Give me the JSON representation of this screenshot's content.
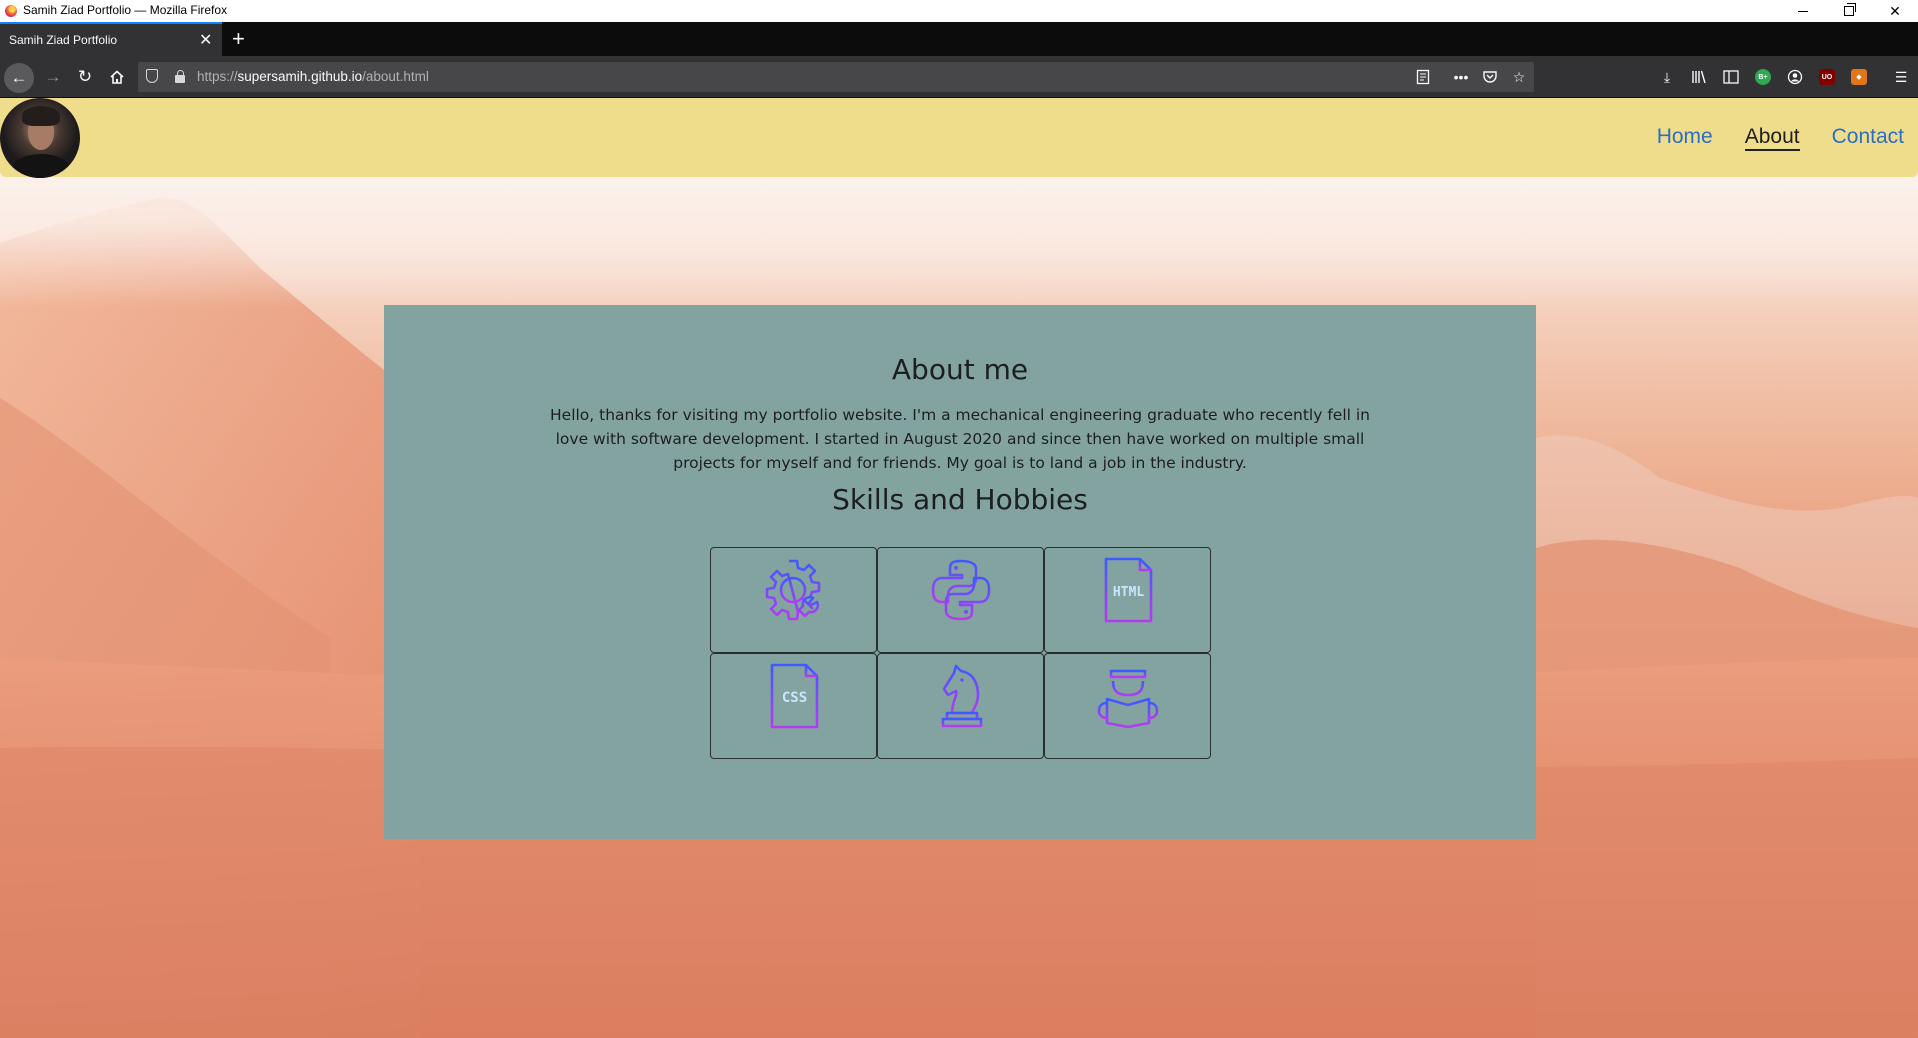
{
  "window": {
    "title": "Samih Ziad Portfolio — Mozilla Firefox"
  },
  "tab": {
    "title": "Samih Ziad Portfolio"
  },
  "urlbar": {
    "scheme": "https://",
    "host": "supersamih.github.io",
    "path": "/about.html"
  },
  "nav": {
    "links": [
      {
        "label": "Home",
        "active": false
      },
      {
        "label": "About",
        "active": true
      },
      {
        "label": "Contact",
        "active": false
      }
    ]
  },
  "about": {
    "title": "About me",
    "text": "Hello, thanks for visiting my portfolio website. I'm a mechanical engineering graduate who recently fell in love with software development. I started in August 2020 and since then have worked on multiple small projects for myself and for friends. My goal is to land a job in the industry."
  },
  "skills": {
    "title": "Skills and Hobbies",
    "items": [
      {
        "icon": "gear-wrench-icon"
      },
      {
        "icon": "python-icon"
      },
      {
        "icon": "html-file-icon",
        "label": "HTML"
      },
      {
        "icon": "css-file-icon",
        "label": "CSS"
      },
      {
        "icon": "chess-knight-icon"
      },
      {
        "icon": "reader-icon"
      }
    ],
    "icon_gradient": [
      "#3d5afe",
      "#b53cf0"
    ]
  },
  "colors": {
    "navbar": "#f0dd8c",
    "card": "#83a3a0",
    "link": "#2b6fc4",
    "active_link": "#1e1f21"
  }
}
